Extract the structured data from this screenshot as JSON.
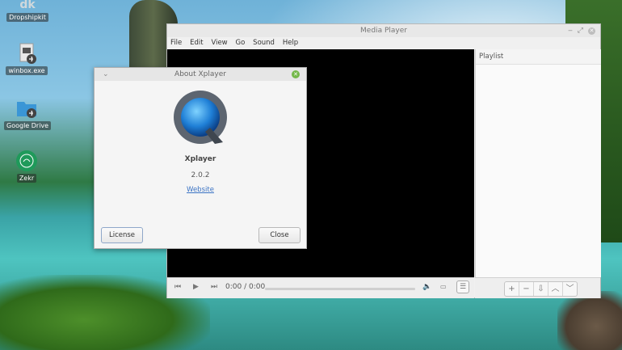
{
  "desktop": {
    "icons": [
      {
        "label": "Dropshipkit",
        "glyph": "dk",
        "icon": "dropshipkit-icon"
      },
      {
        "label": "winbox.exe",
        "icon": "winbox-file-icon"
      },
      {
        "label": "Google Drive",
        "icon": "google-drive-folder-icon"
      },
      {
        "label": "Zekr",
        "icon": "zekr-app-icon"
      }
    ]
  },
  "player": {
    "title": "Media Player",
    "menu": [
      "File",
      "Edit",
      "View",
      "Go",
      "Sound",
      "Help"
    ],
    "playlist_header": "Playlist",
    "time_display": "0:00 / 0:00"
  },
  "about": {
    "title": "About Xplayer",
    "app_name": "Xplayer",
    "version": "2.0.2",
    "website_label": "Website",
    "license_button": "License",
    "close_button": "Close"
  },
  "colors": {
    "accent_link": "#3b73c4",
    "close_green": "#74b84a",
    "video_bg": "#000000"
  }
}
